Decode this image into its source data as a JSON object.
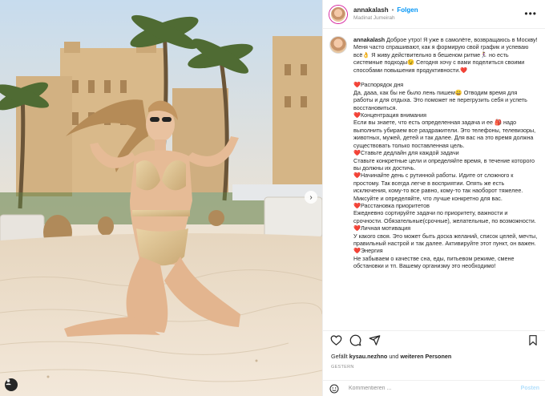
{
  "post": {
    "username": "annakalash",
    "separator": "•",
    "follow_label": "Folgen",
    "location": "Madinat Jumeirah",
    "more_icon": "more-horizontal-icon"
  },
  "caption": {
    "username": "annakalash",
    "text": "Доброе утро! Я уже в самолёте, возвращаюсь в Москву!\nМеня часто спрашивают, как я формирую свой график и успеваю всё👌 Я живу действительно в бешеном ритме🏃‍♀️ но есть системные подходы😉 Сегодня хочу с вами поделиться своими способами повышения продуктивности.❤️\n\n❤️Распорядок дня\nДа, дааа, как бы не было лень пишем😄 Отводим время для работы и для отдыха. Это поможет не перегрузить себя и успеть восстановиться.\n❤️Концентрация внимания\nЕсли вы знаете, что есть определенная задача и ее 🎒 надо выполнить убираем все раздражители. Это телефоны, телевизоры, животных, мужей, детей и так далее. Для вас на это время должна существовать только поставленная цель.\n❤️Ставьте дедлайн для каждой задачи\nСтавьте конкретные цели и определяйте время, в течение которого вы должны их достичь.\n❤️Начинайте день с рутинной работы. Идите от сложного к простому. Так всегда легче в восприятии. Опять же есть исключения, кому-то все равно, кому-то так наоборот тяжелее. Миксуйте и определяйте, что лучше конкретно для вас.\n❤️Расстановка приоритетов\nЕжедневно сортируйте задачи по приоритету, важности и срочности. Обязательные(срочные), желательные, по возможности.\n❤️Личная мотивация\nУ какого своя. Это может быть доска желаний, список целей, мечты, правильный настрой и так далее. Активируйте этот пункт, он важен.\n❤️Энергия\nНе забываем о качестве сна, еды, питьевом режиме, смене обстановки и тп. Вашему организму это необходимо!"
  },
  "actions": {
    "like_icon": "heart-icon",
    "comment_icon": "comment-icon",
    "share_icon": "share-icon",
    "save_icon": "bookmark-icon"
  },
  "likes": {
    "prefix": "Gefällt",
    "user": "kysau.nezhno",
    "connector": "und",
    "others": "weiteren Personen"
  },
  "date_label": "GESTERN",
  "comment": {
    "placeholder": "Kommentieren ...",
    "post_label": "Posten",
    "emoji_icon": "emoji-icon"
  },
  "photo": {
    "next_icon": "chevron-right-icon",
    "tag_icon": "user-tag-icon"
  }
}
